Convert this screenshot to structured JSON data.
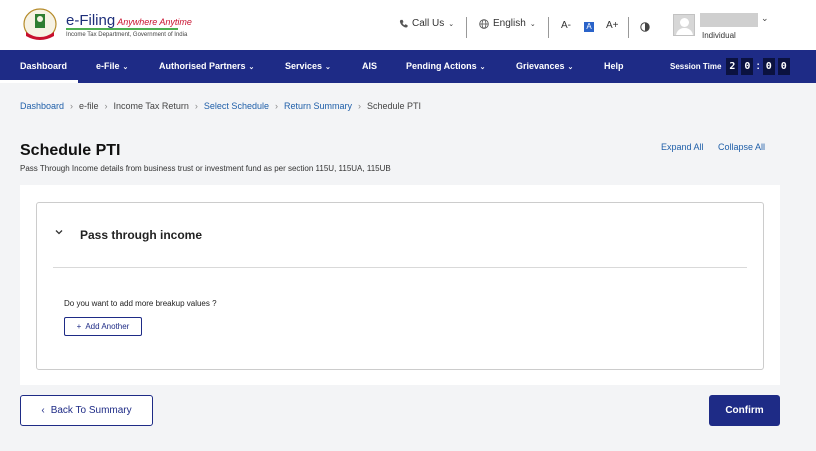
{
  "header": {
    "brand_title": "e-Filing",
    "brand_tagline": "Anywhere Anytime",
    "brand_subtitle": "Income Tax Department, Government of India",
    "call_us": "Call Us",
    "language": "English",
    "font_decrease": "A-",
    "font_normal": "A",
    "font_increase": "A+",
    "user_role": "Individual"
  },
  "nav": {
    "items": [
      {
        "label": "Dashboard"
      },
      {
        "label": "e-File"
      },
      {
        "label": "Authorised Partners"
      },
      {
        "label": "Services"
      },
      {
        "label": "AIS"
      },
      {
        "label": "Pending Actions"
      },
      {
        "label": "Grievances"
      },
      {
        "label": "Help"
      }
    ],
    "active_index": 0,
    "session_label": "Session Time",
    "session_digits": [
      "2",
      "0",
      "0",
      "0"
    ]
  },
  "breadcrumb": [
    {
      "label": "Dashboard",
      "link": true
    },
    {
      "label": "e-file",
      "link": false
    },
    {
      "label": "Income Tax Return",
      "link": false
    },
    {
      "label": "Select Schedule",
      "link": true
    },
    {
      "label": "Return Summary",
      "link": true
    },
    {
      "label": "Schedule PTI",
      "link": false
    }
  ],
  "page": {
    "title": "Schedule PTI",
    "description": "Pass Through Income details from business trust or investment fund as per section 115U, 115UA, 115UB",
    "expand_all": "Expand All",
    "collapse_all": "Collapse All"
  },
  "section": {
    "title": "Pass through income",
    "question": "Do you want to add more breakup values ?",
    "add_button": "Add Another"
  },
  "footer": {
    "back_button": "Back To Summary",
    "confirm_button": "Confirm"
  },
  "colors": {
    "primary": "#1e2b86",
    "link": "#1f5fa9",
    "background": "#f3f4f6"
  }
}
